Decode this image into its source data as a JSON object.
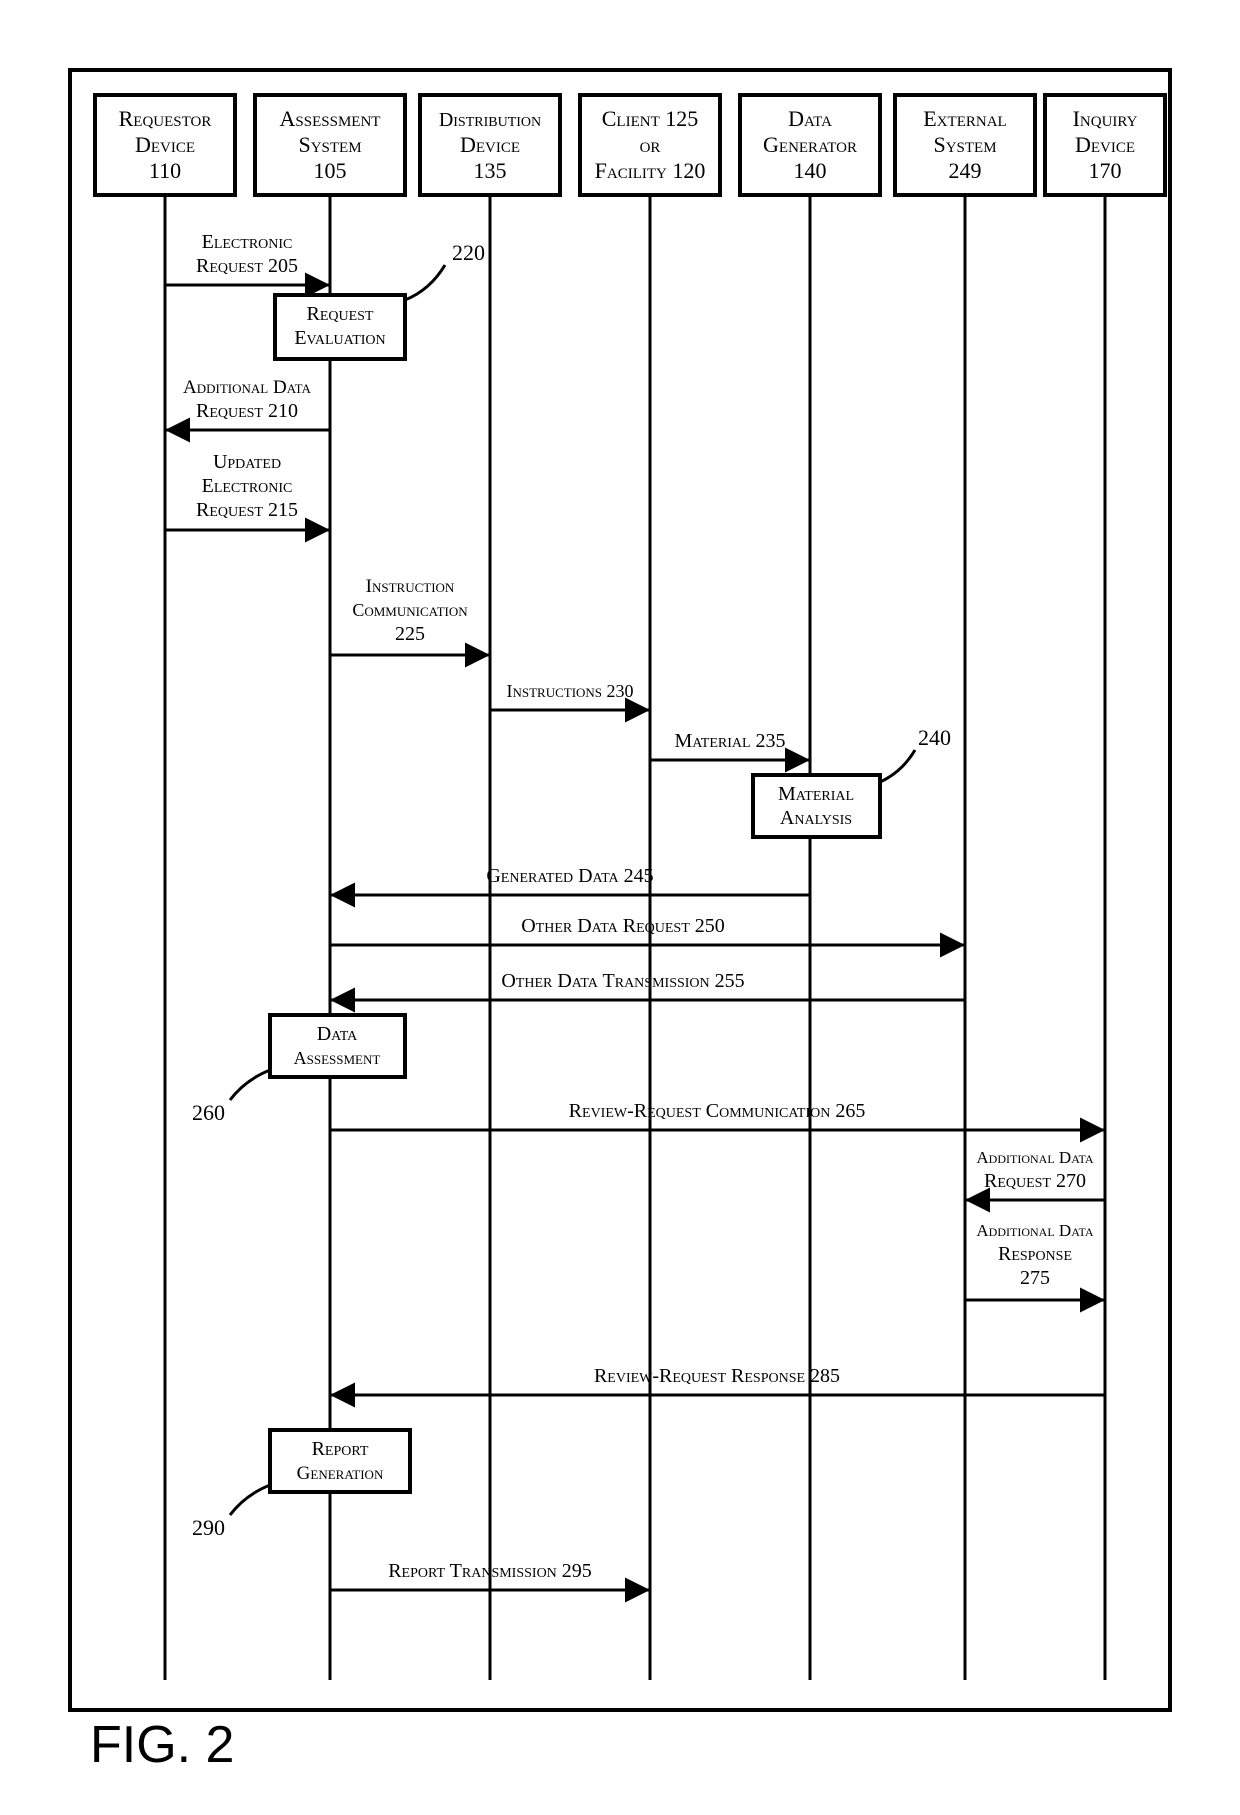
{
  "figure_caption": "FIG. 2",
  "participants": {
    "requestor": {
      "line1": "Requestor",
      "line2": "Device",
      "line3": "110"
    },
    "assessment": {
      "line1": "Assessment",
      "line2": "System",
      "line3": "105"
    },
    "distribution": {
      "line1": "Distribution",
      "line2": "Device",
      "line3": "135"
    },
    "client": {
      "line1": "Client 125",
      "line2": "or",
      "line3": "Facility 120"
    },
    "dataGenerator": {
      "line1": "Data",
      "line2": "Generator",
      "line3": "140"
    },
    "externalSystem": {
      "line1": "External",
      "line2": "System",
      "line3": "249"
    },
    "inquiryDevice": {
      "line1": "Inquiry",
      "line2": "Device",
      "line3": "170"
    }
  },
  "activations": {
    "requestEval": {
      "line1": "Request",
      "line2": "Evaluation",
      "ref": "220"
    },
    "materialAnalysis": {
      "line1": "Material",
      "line2": "Analysis",
      "ref": "240"
    },
    "dataAssessment": {
      "line1": "Data",
      "line2": "Assessment",
      "ref": "260"
    },
    "reportGeneration": {
      "line1": "Report",
      "line2": "Generation",
      "ref": "290"
    }
  },
  "messages": {
    "electronicRequest": {
      "line1": "Electronic",
      "line2": "Request 205"
    },
    "additionalDataRequest210": {
      "line1": "Additional Data",
      "line2": "Request 210"
    },
    "updatedElectronicRequest": {
      "line1": "Updated",
      "line2": "Electronic",
      "line3": "Request 215"
    },
    "instructionCommunication": {
      "line1": "Instruction",
      "line2": "Communication",
      "line3": "225"
    },
    "instructions": {
      "text": "Instructions 230"
    },
    "material": {
      "text": "Material 235"
    },
    "generatedData": {
      "text": "Generated Data 245"
    },
    "otherDataRequest": {
      "text": "Other Data Request 250"
    },
    "otherDataTransmission": {
      "text": "Other Data Transmission 255"
    },
    "reviewRequestCommunication": {
      "text": "Review-Request Communication 265"
    },
    "additionalDataRequest270": {
      "line1": "Additional Data",
      "line2": "Request 270"
    },
    "additionalDataResponse": {
      "line1": "Additional Data",
      "line2": "Response",
      "line3": "275"
    },
    "reviewRequestResponse": {
      "text": "Review-Request Response 285"
    },
    "reportTransmission": {
      "text": "Report Transmission 295"
    }
  }
}
